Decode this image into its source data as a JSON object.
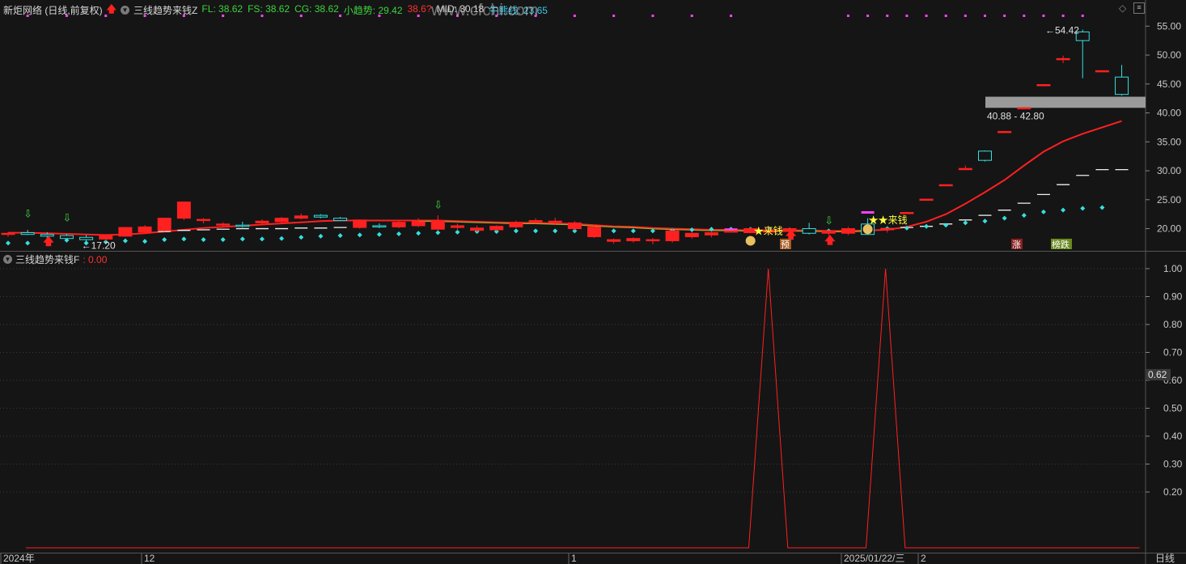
{
  "header": {
    "title": "新炬网络 (日线,前复权)",
    "indicator_name": "三线趋势来钱Z",
    "readouts": [
      {
        "label": "FL:",
        "value": "38.62",
        "color": "#3ed23e"
      },
      {
        "label": "FS:",
        "value": "38.62",
        "color": "#3ed23e"
      },
      {
        "label": "CG:",
        "value": "38.62",
        "color": "#3ed23e"
      },
      {
        "label": "小趋势:",
        "value": "29.42",
        "color": "#3ed23e"
      },
      {
        "label": "",
        "value": "38.6?",
        "color": "#ff3030"
      },
      {
        "label": "MID:",
        "value": "30.18",
        "color": "#d0d0d0"
      },
      {
        "label": "牛熊线:",
        "value": "23.65",
        "color": "#3ec8e8"
      }
    ]
  },
  "watermark": "www.cfchi.com",
  "sub_header": {
    "indicator_name": "三线趋势来钱F",
    "value": ": 0.00"
  },
  "colors": {
    "up": "#ff2020",
    "down": "#35e0e0",
    "line": "#ff2020",
    "background": "#151515",
    "grid": "#3a3a3a",
    "highlight_band": "#9a9a9a",
    "signal": "#ff40ff",
    "text_yellow": "#ffff40"
  },
  "icons": {
    "dropdown": "circle-chevron-icon",
    "up_arrow": "red-up-arrow-icon",
    "settings": "diamond-icon",
    "menu": "square-menu-icon"
  },
  "chart_data": [
    {
      "type": "candlestick",
      "y_ticks": [
        "55.00",
        "50.00",
        "45.00",
        "40.00",
        "35.00",
        "30.00",
        "25.00",
        "20.00"
      ],
      "ylim": [
        17,
        57
      ],
      "candles": [
        {
          "o": 19.0,
          "h": 19.4,
          "l": 18.6,
          "c": 19.2
        },
        {
          "o": 19.3,
          "h": 19.8,
          "l": 18.9,
          "c": 19.0
        },
        {
          "o": 19.0,
          "h": 19.4,
          "l": 18.3,
          "c": 18.7
        },
        {
          "o": 18.8,
          "h": 19.1,
          "l": 18.1,
          "c": 18.3
        },
        {
          "o": 18.5,
          "h": 18.9,
          "l": 17.2,
          "c": 18.1
        },
        {
          "o": 18.2,
          "h": 19.0,
          "l": 17.8,
          "c": 18.9
        },
        {
          "o": 18.7,
          "h": 20.3,
          "l": 18.6,
          "c": 20.2
        },
        {
          "o": 19.4,
          "h": 20.6,
          "l": 19.1,
          "c": 20.3
        },
        {
          "o": 19.7,
          "h": 21.9,
          "l": 19.5,
          "c": 21.8
        },
        {
          "o": 21.8,
          "h": 24.7,
          "l": 21.5,
          "c": 24.6
        },
        {
          "o": 21.4,
          "h": 21.8,
          "l": 20.9,
          "c": 21.6
        },
        {
          "o": 20.6,
          "h": 21.1,
          "l": 20.2,
          "c": 20.8
        },
        {
          "o": 20.6,
          "h": 21.2,
          "l": 20.2,
          "c": 20.5
        },
        {
          "o": 21.0,
          "h": 21.6,
          "l": 20.8,
          "c": 21.3
        },
        {
          "o": 21.2,
          "h": 22.0,
          "l": 21.0,
          "c": 21.8
        },
        {
          "o": 21.8,
          "h": 22.6,
          "l": 21.6,
          "c": 22.2
        },
        {
          "o": 22.3,
          "h": 22.5,
          "l": 21.8,
          "c": 22.0
        },
        {
          "o": 21.8,
          "h": 22.0,
          "l": 21.3,
          "c": 21.4
        },
        {
          "o": 20.2,
          "h": 21.6,
          "l": 20.0,
          "c": 21.5
        },
        {
          "o": 20.5,
          "h": 20.9,
          "l": 20.1,
          "c": 20.4
        },
        {
          "o": 20.3,
          "h": 21.3,
          "l": 20.1,
          "c": 21.1
        },
        {
          "o": 20.5,
          "h": 21.8,
          "l": 20.3,
          "c": 21.2
        },
        {
          "o": 19.9,
          "h": 22.3,
          "l": 19.6,
          "c": 21.4
        },
        {
          "o": 20.2,
          "h": 20.9,
          "l": 19.7,
          "c": 20.5
        },
        {
          "o": 19.7,
          "h": 20.5,
          "l": 19.4,
          "c": 20.1
        },
        {
          "o": 19.8,
          "h": 20.6,
          "l": 19.6,
          "c": 20.4
        },
        {
          "o": 20.3,
          "h": 21.4,
          "l": 20.1,
          "c": 21.1
        },
        {
          "o": 21.3,
          "h": 21.8,
          "l": 20.9,
          "c": 21.4
        },
        {
          "o": 21.2,
          "h": 21.9,
          "l": 20.6,
          "c": 21.3
        },
        {
          "o": 20.0,
          "h": 21.3,
          "l": 19.7,
          "c": 21.0
        },
        {
          "o": 18.6,
          "h": 20.7,
          "l": 18.4,
          "c": 20.3
        },
        {
          "o": 17.8,
          "h": 18.3,
          "l": 17.4,
          "c": 18.1
        },
        {
          "o": 17.9,
          "h": 18.5,
          "l": 17.6,
          "c": 18.3
        },
        {
          "o": 17.9,
          "h": 18.4,
          "l": 17.3,
          "c": 18.1
        },
        {
          "o": 17.9,
          "h": 20.1,
          "l": 17.6,
          "c": 19.6
        },
        {
          "o": 18.6,
          "h": 19.5,
          "l": 18.3,
          "c": 19.2
        },
        {
          "o": 18.9,
          "h": 19.6,
          "l": 18.5,
          "c": 19.3
        },
        {
          "o": 19.5,
          "h": 19.8,
          "l": 19.3,
          "c": 19.6
        },
        {
          "o": 19.3,
          "h": 20.2,
          "l": 19.2,
          "c": 20.0
        },
        {
          "o": 19.4,
          "h": 20.0,
          "l": 19.0,
          "c": 19.8
        },
        {
          "o": 19.5,
          "h": 20.2,
          "l": 19.2,
          "c": 20.0
        },
        {
          "o": 20.0,
          "h": 21.0,
          "l": 19.0,
          "c": 19.2
        },
        {
          "o": 19.2,
          "h": 19.8,
          "l": 18.8,
          "c": 19.6
        },
        {
          "o": 19.2,
          "h": 20.3,
          "l": 18.9,
          "c": 20.0
        },
        {
          "o": 20.8,
          "h": 21.8,
          "l": 18.9,
          "c": 19.0
        },
        {
          "o": 19.8,
          "h": 20.2,
          "l": 19.3,
          "c": 20.0
        },
        {
          "o": 22.8,
          "h": 22.9,
          "l": 22.6,
          "c": 22.8
        },
        {
          "o": 25.1,
          "h": 25.2,
          "l": 25.0,
          "c": 25.1
        },
        {
          "o": 27.6,
          "h": 27.7,
          "l": 27.5,
          "c": 27.6
        },
        {
          "o": 30.4,
          "h": 30.9,
          "l": 30.2,
          "c": 30.4
        },
        {
          "o": 33.4,
          "h": 33.5,
          "l": 31.6,
          "c": 31.8
        },
        {
          "o": 36.8,
          "h": 36.9,
          "l": 36.7,
          "c": 36.8
        },
        {
          "o": 40.9,
          "h": 41.0,
          "l": 40.8,
          "c": 40.9
        },
        {
          "o": 44.9,
          "h": 45.0,
          "l": 44.8,
          "c": 44.9
        },
        {
          "o": 49.4,
          "h": 49.9,
          "l": 48.6,
          "c": 49.4
        },
        {
          "o": 54.0,
          "h": 54.4,
          "l": 46.0,
          "c": 52.5
        },
        {
          "o": 47.3,
          "h": 47.4,
          "l": 47.2,
          "c": 47.3
        },
        {
          "o": 46.2,
          "h": 48.3,
          "l": 43.0,
          "c": 43.2
        }
      ],
      "mid_line": [
        19.3,
        19.3,
        19.2,
        19.1,
        19.0,
        18.9,
        19.0,
        19.2,
        19.5,
        19.8,
        20.1,
        20.3,
        20.5,
        20.7,
        20.9,
        21.1,
        21.3,
        21.4,
        21.4,
        21.4,
        21.4,
        21.4,
        21.4,
        21.3,
        21.2,
        21.1,
        21.0,
        21.0,
        20.9,
        20.8,
        20.6,
        20.4,
        20.3,
        20.1,
        20.0,
        19.9,
        19.8,
        19.8,
        19.7,
        19.7,
        19.7,
        19.7,
        19.6,
        19.6,
        19.7,
        19.8,
        20.3,
        21.2,
        22.5,
        24.3,
        26.3,
        28.4,
        30.9,
        33.3,
        35.1,
        36.4,
        37.5,
        38.6
      ],
      "white_dashes": [
        null,
        null,
        null,
        null,
        null,
        null,
        null,
        null,
        19.5,
        19.7,
        19.8,
        19.9,
        20.0,
        20.0,
        20.0,
        20.1,
        20.1,
        20.2,
        null,
        null,
        null,
        null,
        null,
        null,
        null,
        null,
        null,
        null,
        null,
        null,
        null,
        null,
        null,
        null,
        null,
        null,
        null,
        null,
        null,
        null,
        null,
        null,
        null,
        null,
        null,
        20.0,
        20.2,
        20.4,
        20.8,
        21.5,
        22.3,
        23.2,
        24.4,
        25.9,
        27.6,
        29.2,
        30.2,
        30.2
      ],
      "cyan_dots": [
        17.5,
        17.5,
        17.8,
        18.0,
        17.5,
        17.7,
        17.9,
        17.8,
        18.1,
        18.2,
        18.1,
        18.1,
        18.2,
        18.2,
        18.3,
        18.5,
        18.7,
        18.8,
        18.9,
        19.0,
        19.1,
        19.2,
        19.3,
        19.4,
        19.5,
        19.5,
        19.6,
        19.6,
        19.6,
        19.6,
        19.6,
        19.6,
        19.6,
        19.6,
        19.7,
        19.8,
        19.9,
        19.9,
        19.9,
        19.8,
        19.8,
        19.7,
        19.6,
        19.6,
        19.8,
        20.0,
        20.1,
        20.4,
        20.6,
        21.0,
        21.3,
        21.8,
        22.3,
        22.9,
        23.2,
        23.5,
        23.65
      ],
      "labels": {
        "low_callout": "17.20",
        "high_callout": "54.42",
        "band_text": "40.88 - 42.80",
        "money_text": "来钱",
        "star_money_text": "★来钱",
        "pre_box": "预",
        "rise_box": "涨",
        "fall_box": "榜跌"
      },
      "band": [
        40.88,
        42.8
      ]
    },
    {
      "type": "line",
      "y_ticks": [
        "1.00",
        "0.90",
        "0.80",
        "0.70",
        "0.60",
        "0.50",
        "0.40",
        "0.30",
        "0.20"
      ],
      "ylim": [
        0,
        1
      ],
      "current_value_tag": "0.62",
      "values": [
        0,
        0,
        0,
        0,
        0,
        0,
        0,
        0,
        0,
        0,
        0,
        0,
        0,
        0,
        0,
        0,
        0,
        0,
        0,
        0,
        0,
        0,
        0,
        0,
        0,
        0,
        0,
        0,
        0,
        0,
        0,
        0,
        0,
        0,
        0,
        0,
        0,
        0,
        1,
        0,
        0,
        0,
        0,
        0,
        1,
        0,
        0,
        0,
        0,
        0,
        0,
        0,
        0,
        0,
        0,
        0,
        0,
        0
      ]
    }
  ],
  "x_axis": {
    "labels": [
      "2024年",
      "12",
      "1",
      "2025/01/22/三",
      "2"
    ],
    "period": "日线"
  }
}
